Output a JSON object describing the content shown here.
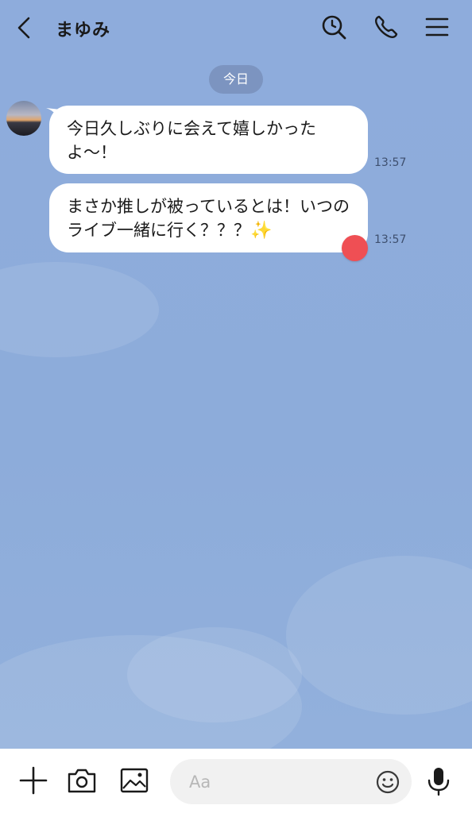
{
  "header": {
    "title": "まゆみ",
    "icons": [
      "back-icon",
      "search-icon",
      "phone-icon",
      "menu-icon"
    ]
  },
  "date_label": "今日",
  "messages": [
    {
      "text": "今日久しぶりに会えて嬉しかったよ〜！",
      "time": "13:57"
    },
    {
      "text": "まさか推しが被っているとは！いつのライブ一緒に行く？？？",
      "emoji": "✨",
      "time": "13:57"
    }
  ],
  "composer": {
    "placeholder": "Aa",
    "icons": [
      "plus-icon",
      "camera-icon",
      "image-icon",
      "emoji-icon",
      "microphone-icon"
    ]
  },
  "colors": {
    "background": "#8fadda",
    "bubble": "#ffffff",
    "reaction": "#ef4f54"
  }
}
